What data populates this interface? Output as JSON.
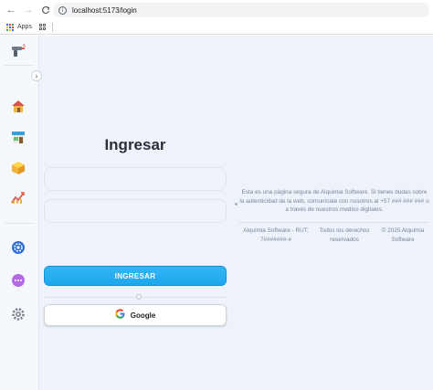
{
  "browser": {
    "back_icon": "←",
    "forward_icon": "→",
    "reload_icon": "C",
    "url": "localhost:5173/login",
    "info_icon": "i"
  },
  "bookmarks": {
    "apps_label": "Apps"
  },
  "sidebar": {
    "collapse_icon": "›",
    "items": [
      {
        "name": "gun-icon",
        "glyph": "🔫"
      },
      {
        "name": "house-icon",
        "glyph": "🏠"
      },
      {
        "name": "shop-icon",
        "glyph": "🏪"
      },
      {
        "name": "box-icon",
        "glyph": "📦"
      },
      {
        "name": "chart-icon",
        "glyph": "📈"
      },
      {
        "name": "settings-icon",
        "glyph": "⚙"
      },
      {
        "name": "more-icon",
        "glyph": "⋯"
      },
      {
        "name": "gear-icon",
        "glyph": "⚙"
      }
    ]
  },
  "login": {
    "title": "Ingresar",
    "username_placeholder": "",
    "password_placeholder": "",
    "submit_label": "INGRESAR",
    "google_label": "Google",
    "google_glyph": "G"
  },
  "footer": {
    "secure_note": "Esta es una página segura de Alquimia Software. Si tienes dudas sobre la autenticidad de la web, comunícate con nosotros al +57 ### ### ### o a través de nuestros medios digitales.",
    "company": "Alquimia Software - RUT: 7#######-#",
    "rights": "Todos los derechos reservados",
    "copyright": "© 2025 Alquimia Software"
  },
  "colors": {
    "primary": "#1ea7ec",
    "background": "#eef3fb",
    "sidebar": "#f5f8fc"
  }
}
